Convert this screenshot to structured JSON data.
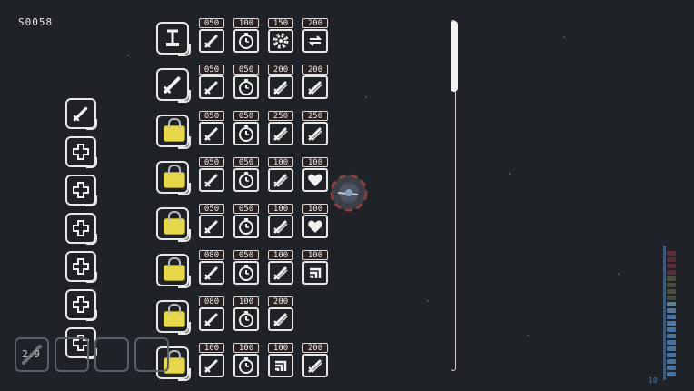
{
  "hud": {
    "score": "S0058",
    "timer": "2.9",
    "gauge_label": "10",
    "gauge_level": 0.62
  },
  "colors": {
    "background": "#1f2227",
    "frame": "#e8e8e8",
    "lock": "#e6d84a",
    "price_bg": "#2a2020"
  },
  "equip_slots": [
    {
      "icon": "sword-icon"
    },
    {
      "icon": "plus-icon"
    },
    {
      "icon": "plus-icon"
    },
    {
      "icon": "plus-icon"
    },
    {
      "icon": "plus-icon"
    },
    {
      "icon": "plus-icon"
    },
    {
      "icon": "plus-icon"
    }
  ],
  "weapons": [
    {
      "icon": "cannon-icon",
      "locked": false,
      "upgrades": [
        {
          "price": "050",
          "icon": "sword-icon"
        },
        {
          "price": "100",
          "icon": "clock-icon"
        },
        {
          "price": "150",
          "icon": "gear-icon"
        },
        {
          "price": "200",
          "icon": "cycle-icon"
        }
      ]
    },
    {
      "icon": "sword-icon",
      "locked": false,
      "upgrades": [
        {
          "price": "050",
          "icon": "sword-icon"
        },
        {
          "price": "050",
          "icon": "clock-icon"
        },
        {
          "price": "200",
          "icon": "double-sword-icon"
        },
        {
          "price": "200",
          "icon": "double-sword-icon"
        }
      ]
    },
    {
      "icon": "lock-icon",
      "locked": true,
      "upgrades": [
        {
          "price": "050",
          "icon": "sword-icon"
        },
        {
          "price": "050",
          "icon": "clock-icon"
        },
        {
          "price": "250",
          "icon": "double-sword-icon"
        },
        {
          "price": "250",
          "icon": "double-sword-icon"
        }
      ]
    },
    {
      "icon": "lock-icon",
      "locked": true,
      "upgrades": [
        {
          "price": "050",
          "icon": "sword-icon"
        },
        {
          "price": "050",
          "icon": "clock-icon"
        },
        {
          "price": "100",
          "icon": "double-sword-icon"
        },
        {
          "price": "100",
          "icon": "heart-icon"
        }
      ]
    },
    {
      "icon": "lock-icon",
      "locked": true,
      "upgrades": [
        {
          "price": "050",
          "icon": "sword-icon"
        },
        {
          "price": "050",
          "icon": "clock-icon"
        },
        {
          "price": "100",
          "icon": "double-sword-icon"
        },
        {
          "price": "100",
          "icon": "heart-icon"
        }
      ]
    },
    {
      "icon": "lock-icon",
      "locked": true,
      "upgrades": [
        {
          "price": "080",
          "icon": "sword-icon"
        },
        {
          "price": "050",
          "icon": "clock-icon"
        },
        {
          "price": "100",
          "icon": "double-sword-icon"
        },
        {
          "price": "100",
          "icon": "stairs-icon"
        }
      ]
    },
    {
      "icon": "lock-icon",
      "locked": true,
      "upgrades": [
        {
          "price": "080",
          "icon": "sword-icon"
        },
        {
          "price": "100",
          "icon": "clock-icon"
        },
        {
          "price": "200",
          "icon": "double-sword-icon"
        }
      ]
    },
    {
      "icon": "lock-icon",
      "locked": true,
      "upgrades": [
        {
          "price": "100",
          "icon": "sword-icon"
        },
        {
          "price": "100",
          "icon": "clock-icon"
        },
        {
          "price": "100",
          "icon": "stairs-icon"
        },
        {
          "price": "200",
          "icon": "double-sword-icon"
        }
      ]
    }
  ]
}
